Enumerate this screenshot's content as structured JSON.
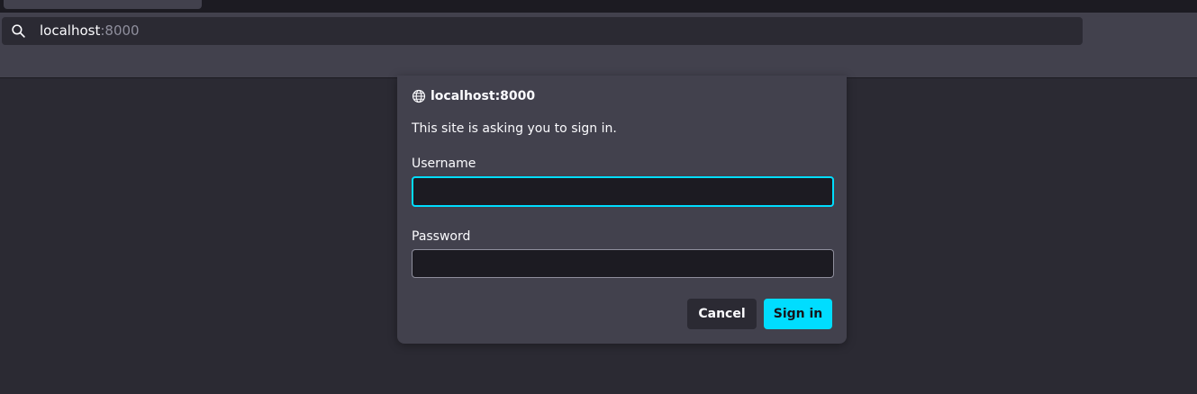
{
  "browser": {
    "url_host": "localhost",
    "url_port": ":8000",
    "search_icon": "search-icon"
  },
  "dialog": {
    "globe_icon": "globe-icon",
    "origin": "localhost:8000",
    "message": "This site is asking you to sign in.",
    "username_label": "Username",
    "username_value": "",
    "password_label": "Password",
    "password_value": "",
    "cancel_label": "Cancel",
    "signin_label": "Sign in"
  },
  "colors": {
    "accent": "#00ddff",
    "dialog_bg": "#42414d",
    "page_bg": "#2b2a33"
  }
}
